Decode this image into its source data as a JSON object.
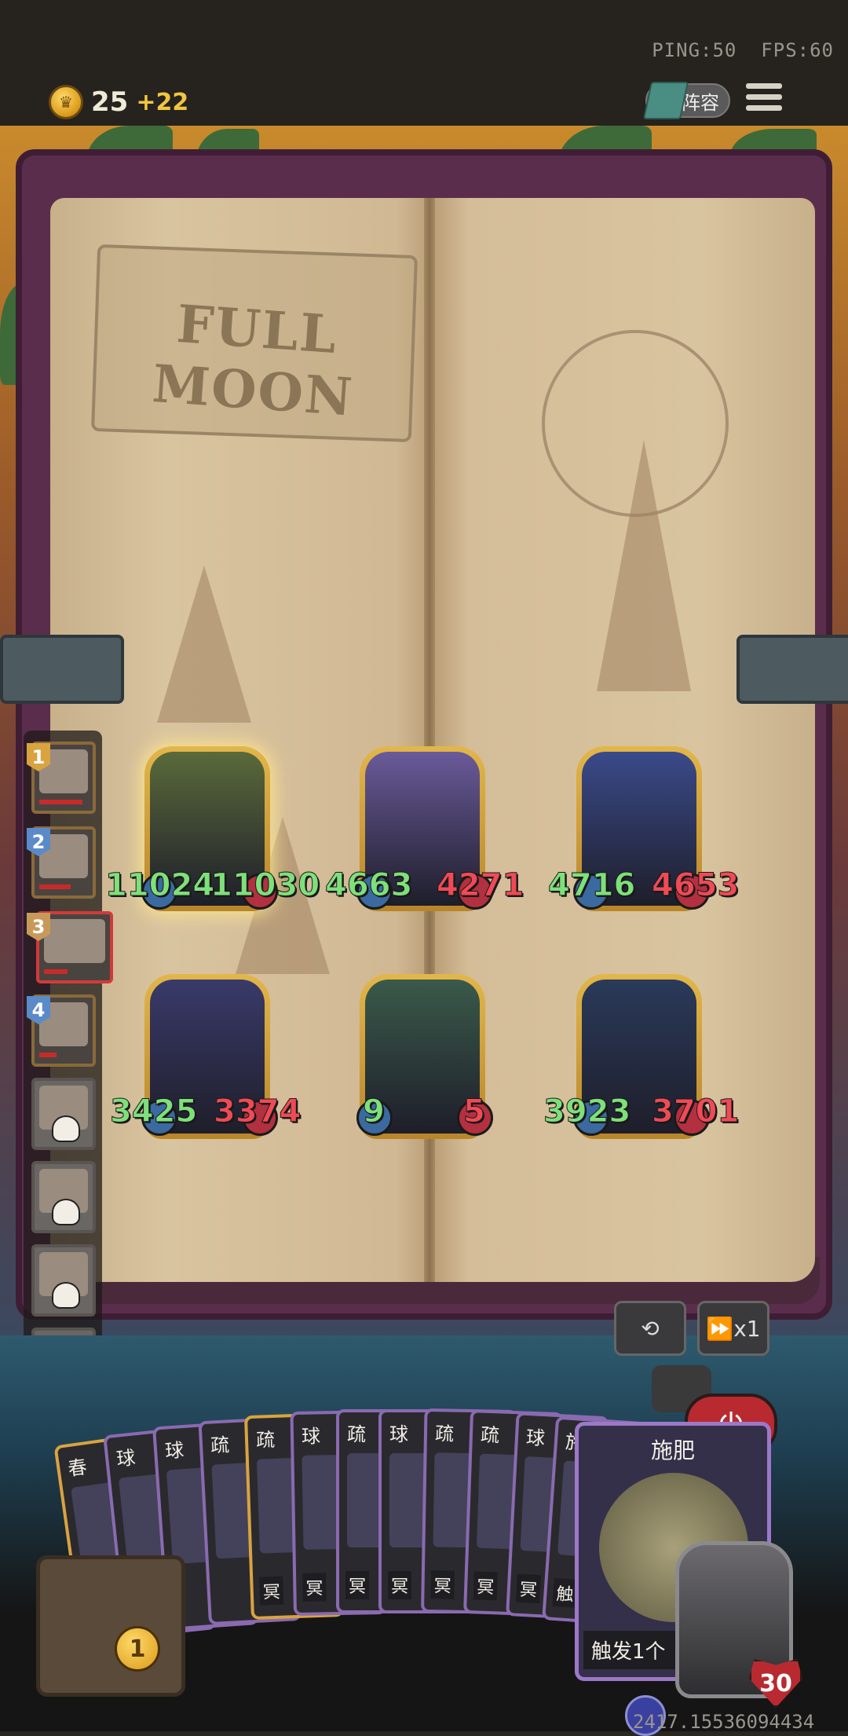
{
  "network": {
    "ping": "PING:50",
    "fps": "FPS:60"
  },
  "resources": {
    "gold": "25",
    "gold_income": "+22",
    "coin_icon": "crown-coin-icon"
  },
  "header": {
    "lineup_label": "阵容"
  },
  "board": {
    "title": "FULL MOON",
    "heroes": [
      {
        "atk": "11024",
        "hp": "11030",
        "selected": true,
        "color": "#5a6a3a"
      },
      {
        "atk": "4663",
        "hp": "4271",
        "selected": false,
        "color": "#6a5a9a"
      },
      {
        "atk": "4716",
        "hp": "4653",
        "selected": false,
        "color": "#3a4a8a"
      },
      {
        "atk": "3425",
        "hp": "3374",
        "selected": false,
        "color": "#3a3a6a"
      },
      {
        "atk": "9",
        "hp": "5",
        "selected": false,
        "color": "#3a5a4a"
      },
      {
        "atk": "3923",
        "hp": "3701",
        "selected": false,
        "color": "#2a3a5a"
      }
    ]
  },
  "roster": [
    {
      "rank": "1",
      "state": "alive",
      "badge_color": "#d9a340"
    },
    {
      "rank": "2",
      "state": "alive",
      "badge_color": "#5a8ac8"
    },
    {
      "rank": "3",
      "state": "active",
      "badge_color": "#c89a5a"
    },
    {
      "rank": "4",
      "state": "alive",
      "badge_color": "#5a8ac8"
    },
    {
      "rank": "",
      "state": "dead"
    },
    {
      "rank": "",
      "state": "dead"
    },
    {
      "rank": "",
      "state": "dead"
    },
    {
      "rank": "",
      "state": "dead"
    }
  ],
  "controls": {
    "speed": "x1"
  },
  "hand": [
    {
      "name": "春",
      "desc": "",
      "gold": true
    },
    {
      "name": "球",
      "desc": "",
      "gold": false
    },
    {
      "name": "球",
      "desc": "",
      "gold": false
    },
    {
      "name": "疏",
      "desc": "",
      "gold": false
    },
    {
      "name": "疏",
      "desc": "冥",
      "gold": true
    },
    {
      "name": "球",
      "desc": "冥",
      "gold": false
    },
    {
      "name": "疏",
      "desc": "冥",
      "gold": false
    },
    {
      "name": "球",
      "desc": "冥",
      "gold": false
    },
    {
      "name": "疏",
      "desc": "冥",
      "gold": false
    },
    {
      "name": "疏",
      "desc": "冥",
      "gold": false
    },
    {
      "name": "球",
      "desc": "冥",
      "gold": false
    },
    {
      "name": "施",
      "desc": "触",
      "gold": false
    }
  ],
  "featured_card": {
    "name": "施肥",
    "desc": "触发1个"
  },
  "deck": {
    "count": "1"
  },
  "player": {
    "hp": "30"
  },
  "session_id": "2417.15536094434"
}
